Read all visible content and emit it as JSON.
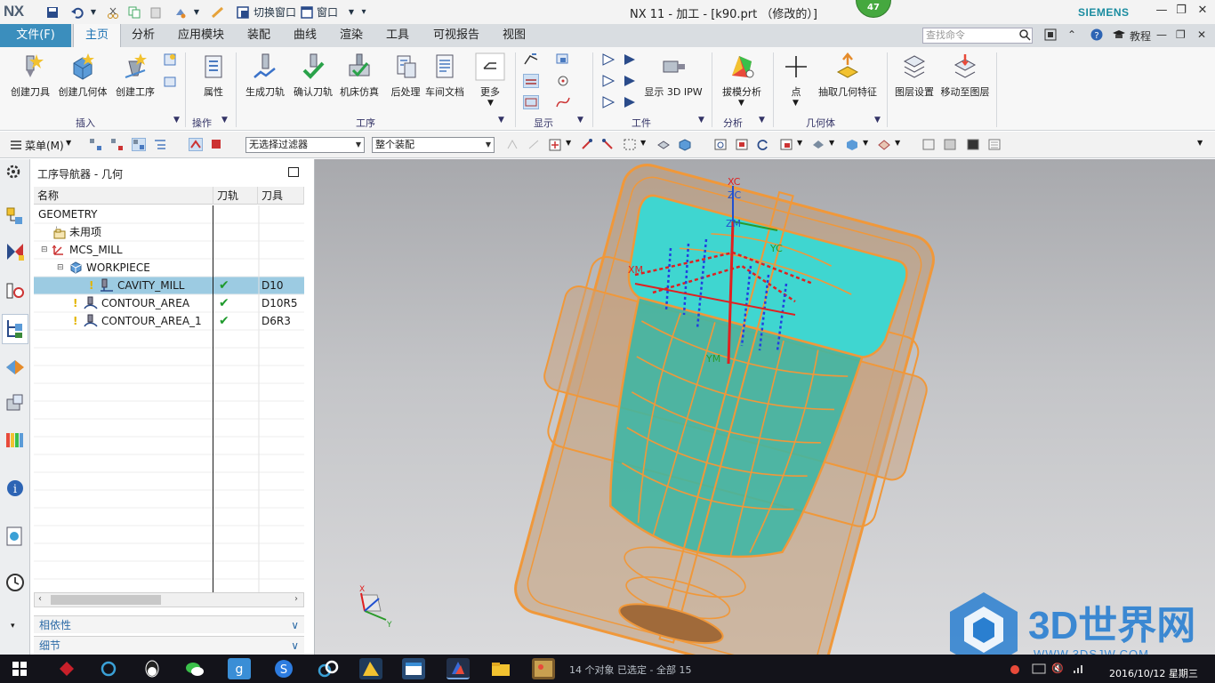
{
  "titlebar": {
    "logo": "NX",
    "switch_window": "切换窗口",
    "window_menu": "窗口",
    "title": "NX 11 - 加工 - [k90.prt （修改的）]",
    "badge": "47",
    "brand": "SIEMENS"
  },
  "tabbar": {
    "file": "文件(F)",
    "tabs": [
      "主页",
      "分析",
      "应用模块",
      "装配",
      "曲线",
      "渲染",
      "工具",
      "可视报告",
      "视图"
    ],
    "active": "主页",
    "search_placeholder": "查找命令",
    "tutorial": "教程"
  },
  "ribbon": {
    "insert": [
      "创建刀具",
      "创建几何体",
      "创建工序"
    ],
    "insert_group": "插入",
    "attribute": "属性",
    "operation_group": "操作",
    "process": [
      "生成刀轨",
      "确认刀轨",
      "机床仿真",
      "后处理",
      "车间文档"
    ],
    "more": "更多",
    "process_group": "工序",
    "display_group": "显示",
    "show_ipw": "显示 3D IPW",
    "workpiece_group": "工件",
    "draft_analysis": "拔模分析",
    "analysis_group": "分析",
    "point": "点",
    "extract_geometry": "抽取几何特征",
    "geometry_group": "几何体",
    "layer_settings": "图层设置",
    "move_to_layer": "移动至图层"
  },
  "toolbar2": {
    "menu": "菜单(M)",
    "filter": "无选择过滤器",
    "assembly": "整个装配"
  },
  "navigator": {
    "title": "工序导航器 - 几何",
    "columns": [
      "名称",
      "刀轨",
      "刀具"
    ],
    "rows": [
      {
        "name": "GEOMETRY",
        "path": "",
        "tool": ""
      },
      {
        "name": "未用项",
        "path": "",
        "tool": ""
      },
      {
        "name": "MCS_MILL",
        "path": "",
        "tool": ""
      },
      {
        "name": "WORKPIECE",
        "path": "",
        "tool": ""
      },
      {
        "name": "CAVITY_MILL",
        "path": "✔",
        "tool": "D10"
      },
      {
        "name": "CONTOUR_AREA",
        "path": "✔",
        "tool": "D10R5"
      },
      {
        "name": "CONTOUR_AREA_1",
        "path": "✔",
        "tool": "D6R3"
      }
    ],
    "dependencies": "相依性",
    "details": "细节"
  },
  "viewport": {
    "axes": {
      "xc": "XC",
      "zc": "ZC",
      "ym": "YM",
      "yc": "YC",
      "xm": "XM",
      "zm": "ZM"
    },
    "triad": {
      "x": "X",
      "y": "Y"
    }
  },
  "taskbar": {
    "status": "14 个对象 已选定 - 全部 15",
    "clock": "2016/10/12 星期三"
  },
  "watermark": {
    "brand": "3D世界网",
    "url": "WWW.3DSJW.COM"
  },
  "colors": {
    "accent": "#3b8ebd",
    "model_orange": "#f0983a",
    "cavity_cyan": "#3fd6d0",
    "selected_row": "#9ccbe2"
  }
}
